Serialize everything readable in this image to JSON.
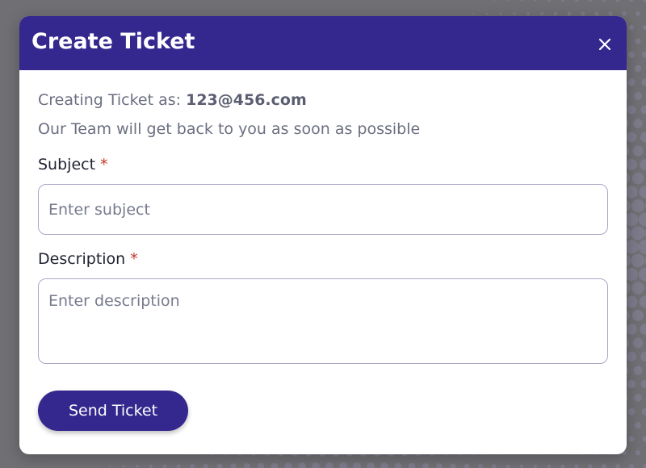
{
  "colors": {
    "backdrop": "#707074",
    "brand": "#34278e",
    "required": "#c0392b",
    "input_border": "#a9a8c6"
  },
  "modal": {
    "title": "Create Ticket",
    "close_icon": "close-icon",
    "info": {
      "creating_prefix": "Creating Ticket as:",
      "email": "123@456.com",
      "message": "Our Team will get back to you as soon as possible"
    },
    "subject": {
      "label": "Subject",
      "required_mark": "*",
      "value": "",
      "placeholder": "Enter subject"
    },
    "description": {
      "label": "Description",
      "required_mark": "*",
      "value": "",
      "placeholder": "Enter description"
    },
    "send_label": "Send Ticket"
  }
}
